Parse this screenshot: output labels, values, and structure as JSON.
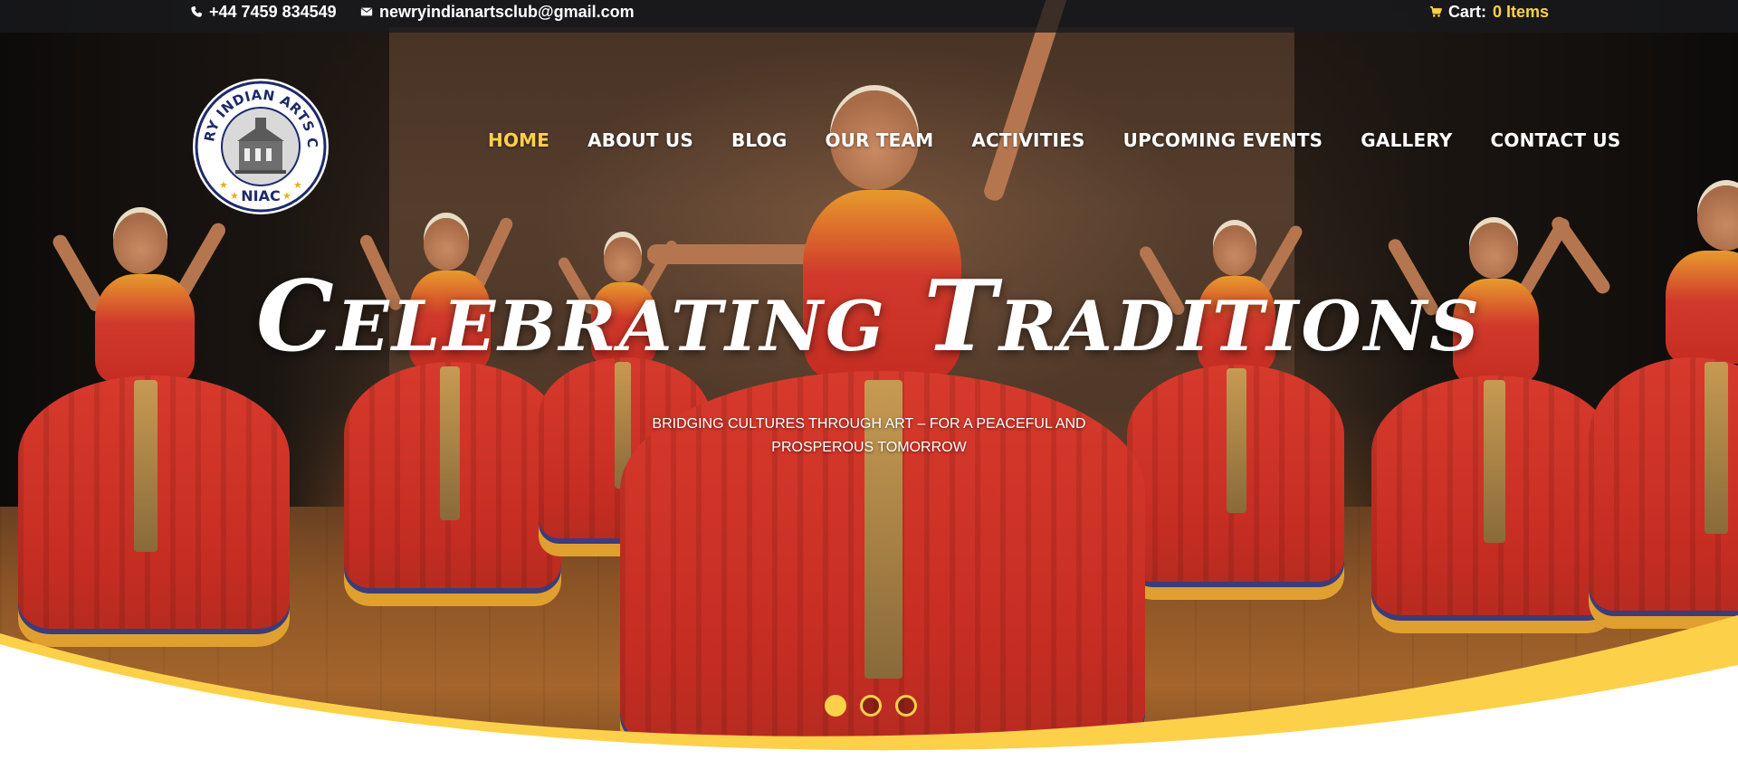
{
  "top_bar": {
    "phone": "+44 7459 834549",
    "email": "newryindianartsclub@gmail.com",
    "cart_label": "Cart:",
    "cart_items": "0 Items"
  },
  "logo": {
    "name": "NEWRY INDIAN ARTS CLUB",
    "abbr": "NIAC"
  },
  "nav": {
    "items": [
      {
        "label": "HOME",
        "active": true
      },
      {
        "label": "ABOUT US"
      },
      {
        "label": "BLOG"
      },
      {
        "label": "OUR TEAM"
      },
      {
        "label": "ACTIVITIES"
      },
      {
        "label": "UPCOMING EVENTS"
      },
      {
        "label": "GALLERY"
      },
      {
        "label": "CONTACT US"
      }
    ]
  },
  "hero": {
    "headline": "Celebrating Traditions",
    "subline": "BRIDGING CULTURES THROUGH ART – FOR A PEACEFUL AND PROSPEROUS TOMORROW",
    "slider": {
      "count": 3,
      "active_index": 0
    }
  },
  "icons": {
    "phone": "phone-icon",
    "email": "envelope-icon",
    "cart": "cart-icon"
  },
  "colors": {
    "accent": "#fdd04a",
    "top_bar_bg": "#181a1e",
    "text": "#ffffff"
  }
}
